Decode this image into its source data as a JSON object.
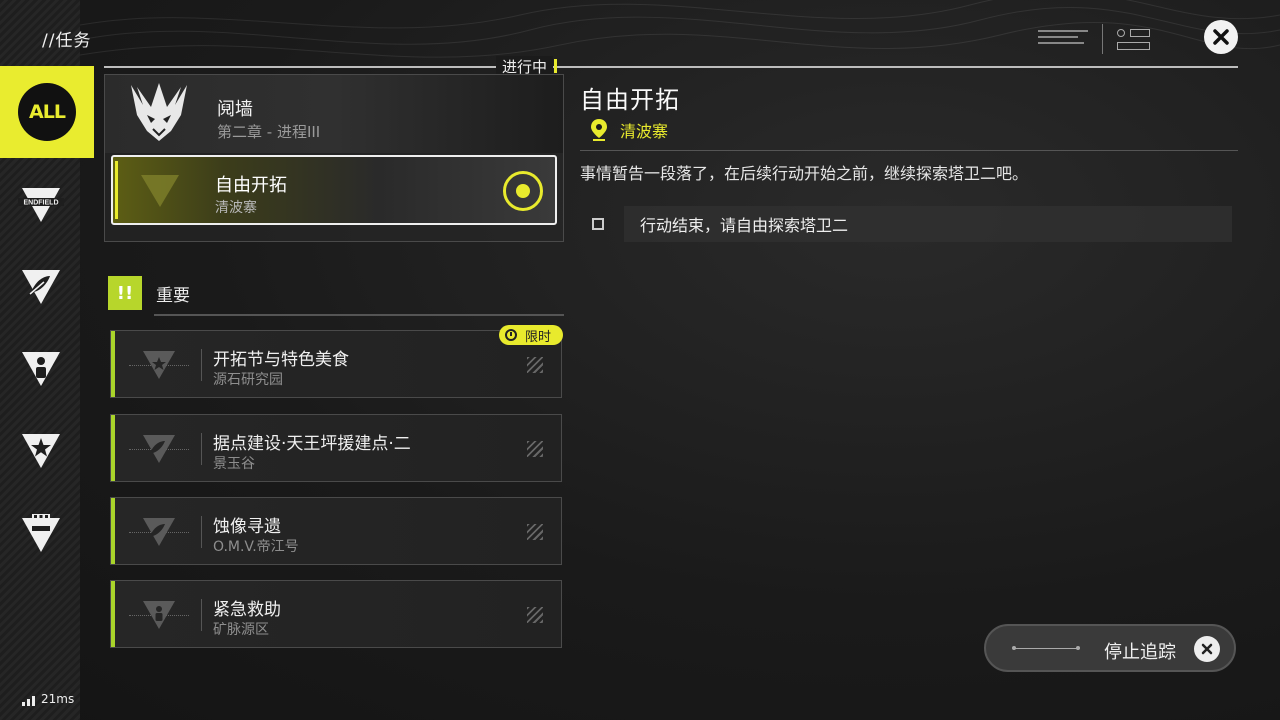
{
  "header": {
    "title": "//任务",
    "status_tag": "进行中"
  },
  "sidebar": {
    "items": [
      {
        "label": "ALL",
        "icon": "all-icon",
        "selected": true
      },
      {
        "label": "ENDFIELD",
        "icon": "endfield-icon"
      },
      {
        "label": "",
        "icon": "feather-icon"
      },
      {
        "label": "",
        "icon": "person-icon"
      },
      {
        "label": "",
        "icon": "star-icon"
      },
      {
        "label": "",
        "icon": "building-icon"
      }
    ]
  },
  "chapter": {
    "title": "阋墙",
    "subtitle": "第二章 - 进程III"
  },
  "active_quest": {
    "title": "自由开拓",
    "location": "清波寨"
  },
  "important": {
    "label": "重要",
    "badge": "!!",
    "quests": [
      {
        "title": "开拓节与特色美食",
        "location": "源石研究园",
        "tag": "限时"
      },
      {
        "title": "据点建设·天王坪援建点·二",
        "location": "景玉谷"
      },
      {
        "title": "蚀像寻遗",
        "location": "O.M.V.帝江号"
      },
      {
        "title": "紧急救助",
        "location": "矿脉源区"
      }
    ]
  },
  "detail": {
    "title": "自由开拓",
    "location": "清波寨",
    "description": "事情暂告一段落了，在后续行动开始之前，继续探索塔卫二吧。",
    "objective": "行动结束，请自由探索塔卫二"
  },
  "stop_tracking_label": "停止追踪",
  "ping": "21ms",
  "colors": {
    "accent": "#e8ea2d",
    "green": "#a9d42a"
  }
}
